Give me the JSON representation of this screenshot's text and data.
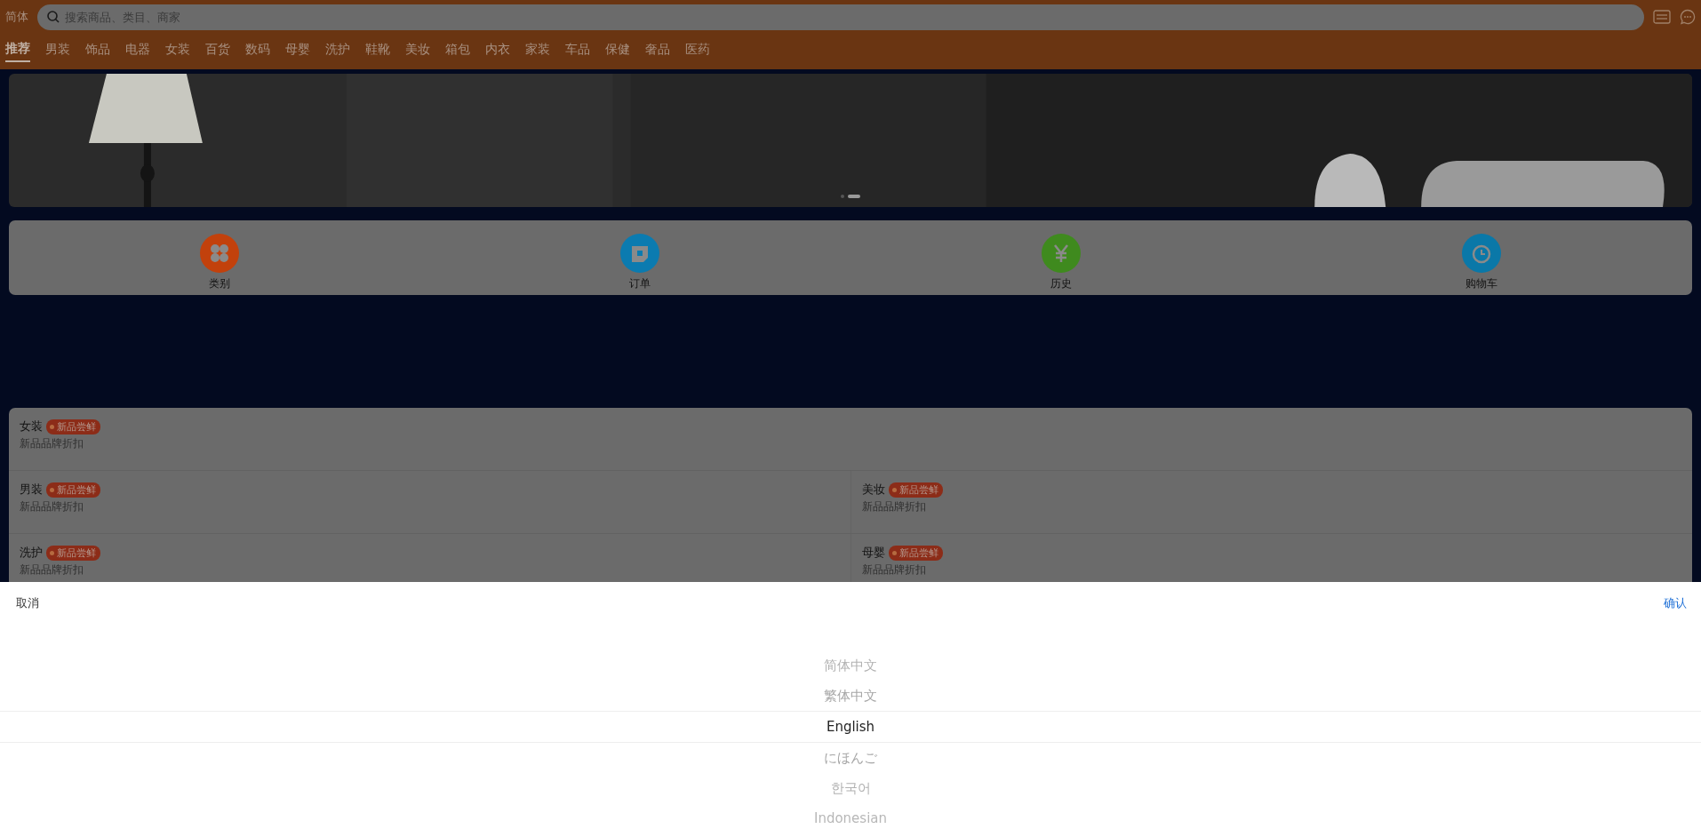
{
  "header": {
    "language": "简体",
    "search": {
      "placeholder": "搜索商品、类目、商家"
    }
  },
  "tabs": [
    {
      "label": "推荐",
      "selected": true
    },
    {
      "label": "男装",
      "selected": false
    },
    {
      "label": "饰品",
      "selected": false
    },
    {
      "label": "电器",
      "selected": false
    },
    {
      "label": "女装",
      "selected": false
    },
    {
      "label": "百货",
      "selected": false
    },
    {
      "label": "数码",
      "selected": false
    },
    {
      "label": "母婴",
      "selected": false
    },
    {
      "label": "洗护",
      "selected": false
    },
    {
      "label": "鞋靴",
      "selected": false
    },
    {
      "label": "美妆",
      "selected": false
    },
    {
      "label": "箱包",
      "selected": false
    },
    {
      "label": "内衣",
      "selected": false
    },
    {
      "label": "家装",
      "selected": false
    },
    {
      "label": "车品",
      "selected": false
    },
    {
      "label": "保健",
      "selected": false
    },
    {
      "label": "奢品",
      "selected": false
    },
    {
      "label": "医药",
      "selected": false
    }
  ],
  "banner": {
    "kind": "picture",
    "dots": [
      {
        "selected": false
      },
      {
        "selected": true
      }
    ]
  },
  "shortcuts": [
    {
      "label": "类别",
      "kind": "grid",
      "color": "#c2410c"
    },
    {
      "label": "订单",
      "kind": "note",
      "color": "#0b7bb0"
    },
    {
      "label": "历史",
      "kind": "yen",
      "color": "#3f8a1e"
    },
    {
      "label": "购物车",
      "kind": "clock",
      "color": "#0a78a8"
    }
  ],
  "sections": [
    [
      {
        "title": "女装",
        "tag": "新品尝鲜",
        "subtitle": "新品品牌折扣"
      }
    ],
    [
      {
        "title": "男装",
        "tag": "新品尝鲜",
        "subtitle": "新品品牌折扣"
      },
      {
        "title": "美妆",
        "tag": "新品尝鲜",
        "subtitle": "新品品牌折扣"
      }
    ],
    [
      {
        "title": "洗护",
        "tag": "新品尝鲜",
        "subtitle": "新品品牌折扣"
      },
      {
        "title": "母婴",
        "tag": "新品尝鲜",
        "subtitle": "新品品牌折扣"
      }
    ]
  ],
  "picker": {
    "cancel": "取消",
    "confirm": "确认",
    "options": [
      {
        "label": "简体中文",
        "selected": false
      },
      {
        "label": "繁体中文",
        "selected": false
      },
      {
        "label": "English",
        "selected": true
      },
      {
        "label": "にほんご",
        "selected": false
      },
      {
        "label": "한국어",
        "selected": false
      },
      {
        "label": "Indonesian",
        "selected": false
      }
    ]
  }
}
